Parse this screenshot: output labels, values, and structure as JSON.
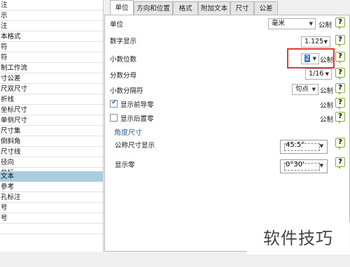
{
  "tree": {
    "items": [
      {
        "label": "注"
      },
      {
        "label": "示"
      },
      {
        "label": "注"
      },
      {
        "label": "本格式"
      },
      {
        "label": "符"
      },
      {
        "label": "符"
      },
      {
        "label": "制工作流"
      },
      {
        "label": "寸公差"
      },
      {
        "label": "尺双尺寸"
      },
      {
        "label": "折线"
      },
      {
        "label": "坐标尺寸"
      },
      {
        "label": "单侧尺寸"
      },
      {
        "label": "尺寸集"
      },
      {
        "label": "倒斜角"
      },
      {
        "label": "尺寸线"
      },
      {
        "label": "径向"
      },
      {
        "label": "坐标"
      },
      {
        "label": "文本"
      },
      {
        "label": "参考"
      },
      {
        "label": "孔标注"
      },
      {
        "label": "号"
      },
      {
        "label": "号"
      },
      {
        "label": ""
      },
      {
        "label": ""
      }
    ],
    "selected_index": 17
  },
  "tabs": [
    {
      "label": "单位"
    },
    {
      "label": "方向和位置"
    },
    {
      "label": "格式"
    },
    {
      "label": "附加文本"
    },
    {
      "label": "尺寸"
    },
    {
      "label": "公差"
    }
  ],
  "form": {
    "units_label": "单位",
    "units_value": "毫米",
    "numeric_display_label": "数字显示",
    "numeric_display_value": "1.125",
    "decimal_places_label": "小数位数",
    "decimal_places_value": "2",
    "fraction_denominator_label": "分数分母",
    "fraction_denominator_value": "1/16",
    "decimal_separator_label": "小数分隔符",
    "decimal_separator_value": "句点",
    "show_leading_zeros_label": "显示前导零",
    "show_leading_zeros_checked": true,
    "show_trailing_zeros_label": "显示后置零",
    "show_trailing_zeros_checked": false,
    "metric_label": "公制",
    "help_label": "?"
  },
  "angle_section": {
    "title": "角度尺寸",
    "nominal_display_label": "公称尺寸显示",
    "nominal_display_value": "45.5°",
    "show_zero_label": "显示零",
    "show_zero_value": "0°30'"
  },
  "watermark": {
    "text": "软件技巧"
  },
  "colors": {
    "selection": "#a9cde0",
    "highlight_box": "#e53935",
    "help_icon_border": "#7ab52a",
    "section_title": "#2f5f97"
  }
}
